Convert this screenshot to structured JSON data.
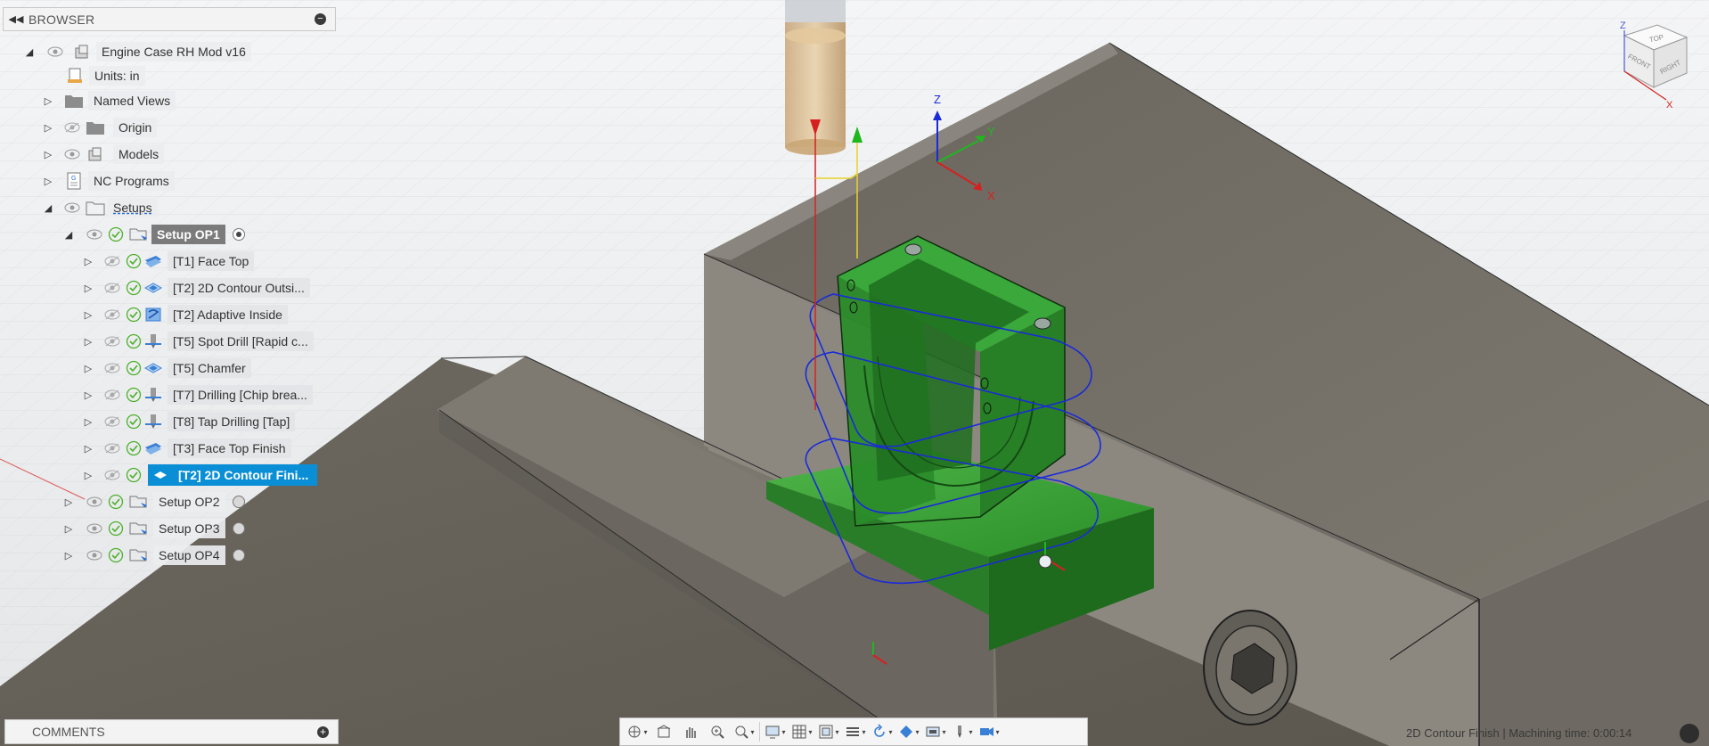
{
  "browser": {
    "title": "BROWSER",
    "collapse_icon": "double-chevron-left",
    "minimize_icon": "minus-circle"
  },
  "tree": {
    "root": "Engine Case RH Mod v16",
    "units": "Units: in",
    "named_views": "Named Views",
    "origin": "Origin",
    "models": "Models",
    "nc_programs": "NC Programs",
    "setups": "Setups",
    "setup_op1": "Setup OP1",
    "operations": [
      {
        "label": "[T1] Face Top",
        "icon": "face-op-icon"
      },
      {
        "label": "[T2] 2D Contour Outsi...",
        "icon": "contour-op-icon"
      },
      {
        "label": "[T2] Adaptive Inside",
        "icon": "adaptive-op-icon"
      },
      {
        "label": "[T5] Spot Drill [Rapid c...",
        "icon": "drill-op-icon"
      },
      {
        "label": "[T5] Chamfer",
        "icon": "chamfer-op-icon"
      },
      {
        "label": "[T7] Drilling [Chip brea...",
        "icon": "drill-op-icon"
      },
      {
        "label": "[T8] Tap Drilling [Tap]",
        "icon": "drill-op-icon"
      },
      {
        "label": "[T3] Face Top Finish",
        "icon": "face-op-icon"
      },
      {
        "label": "[T2] 2D Contour Fini...",
        "icon": "contour-op-icon"
      }
    ],
    "setup_op2": "Setup OP2",
    "setup_op3": "Setup OP3",
    "setup_op4": "Setup OP4"
  },
  "comments": {
    "title": "COMMENTS",
    "add_icon": "plus-circle"
  },
  "toolbar": {
    "items": [
      "orbit-icon",
      "home-icon",
      "pan-icon",
      "zoom-icon",
      "zoom-window-icon",
      "display-icon",
      "grid-icon",
      "viewports-icon",
      "stock-icon",
      "refresh-icon",
      "material-icon",
      "camera-icon",
      "tool-icon",
      "simulate-icon"
    ]
  },
  "viewcube": {
    "top": "TOP",
    "front": "FRONT",
    "right": "RIGHT",
    "z": "Z",
    "x": "X"
  },
  "triad": {
    "x": "X",
    "y": "Y",
    "z": "Z"
  },
  "status": {
    "text": "2D Contour Finish | Machining time: 0:00:14"
  },
  "colors": {
    "part_green": "#2f9a2f",
    "vise_gray": "#6e6a62",
    "toolpath_blue": "#1a2ad8",
    "selection_blue": "#0a8fd6"
  }
}
